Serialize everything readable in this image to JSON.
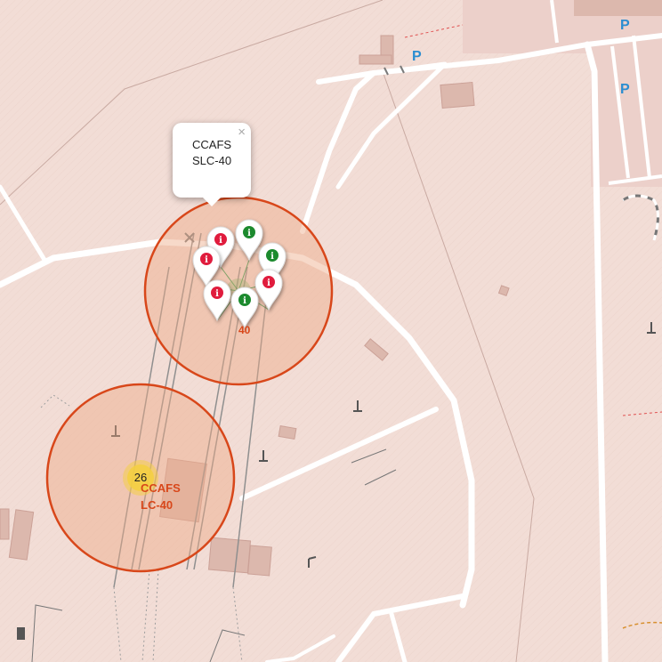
{
  "popup": {
    "text": "CCAFS SLC-40",
    "close_symbol": "×"
  },
  "cluster": {
    "count": "26"
  },
  "site_label": {
    "text": "CCAFS LC-40"
  },
  "under_label": {
    "text": "40"
  },
  "parking_symbol": "P",
  "markers": [
    {
      "status": "red",
      "icon": "info-icon"
    },
    {
      "status": "green",
      "icon": "info-icon"
    },
    {
      "status": "red",
      "icon": "info-icon"
    },
    {
      "status": "green",
      "icon": "info-icon"
    },
    {
      "status": "red",
      "icon": "info-icon"
    },
    {
      "status": "red",
      "icon": "info-icon"
    },
    {
      "status": "green",
      "icon": "info-icon"
    }
  ],
  "colors": {
    "map_background": "#f2ddd6",
    "circle_fill": "#eeaa88",
    "circle_stroke": "#d8471a",
    "marker_red": "#e01b3c",
    "marker_green": "#1e8a2e",
    "cluster_fill": "#f4d03f",
    "parking_text": "#2a8dd1"
  }
}
